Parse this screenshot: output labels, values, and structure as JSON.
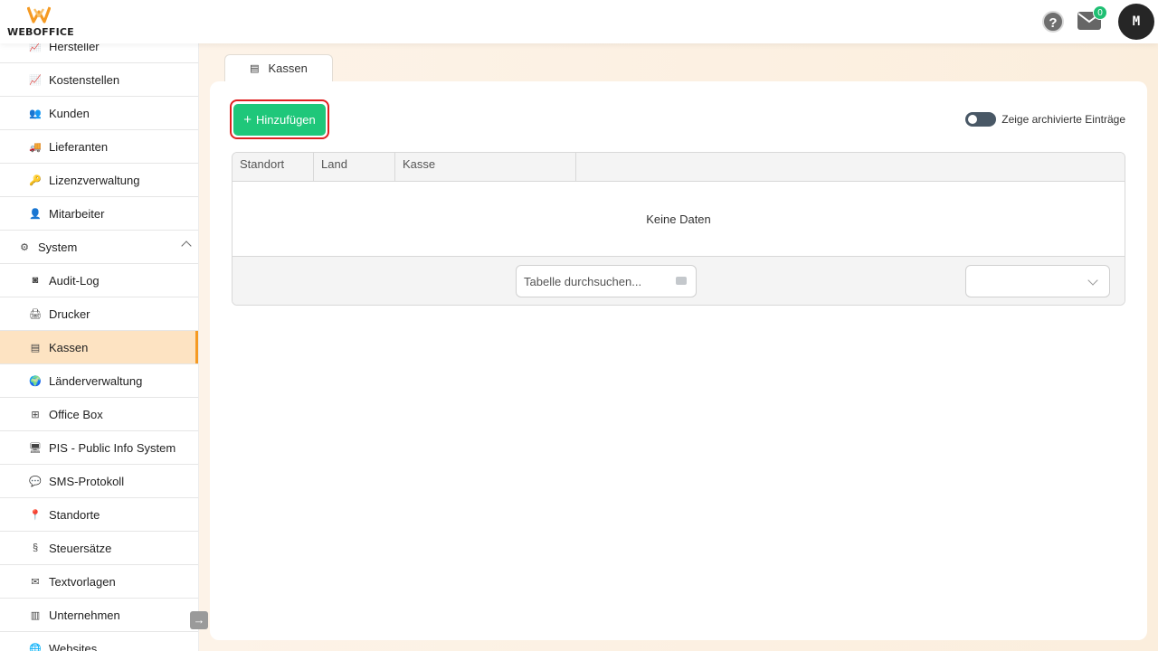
{
  "app": {
    "logo_text": "WEBOFFICE"
  },
  "header": {
    "help_label": "?",
    "mail_count": "0",
    "avatar_initial": "M"
  },
  "sidebar": {
    "items": [
      {
        "label": "Hersteller",
        "icon": "chart-icon"
      },
      {
        "label": "Kostenstellen",
        "icon": "chart-icon"
      },
      {
        "label": "Kunden",
        "icon": "users-icon"
      },
      {
        "label": "Lieferanten",
        "icon": "truck-icon"
      },
      {
        "label": "Lizenzverwaltung",
        "icon": "key-icon"
      },
      {
        "label": "Mitarbeiter",
        "icon": "user-icon"
      },
      {
        "label": "System",
        "icon": "gears-icon"
      },
      {
        "label": "Audit-Log",
        "icon": "audit-icon"
      },
      {
        "label": "Drucker",
        "icon": "printer-icon"
      },
      {
        "label": "Kassen",
        "icon": "cash-register-icon"
      },
      {
        "label": "Länderverwaltung",
        "icon": "globe-icon"
      },
      {
        "label": "Office Box",
        "icon": "sitemap-icon"
      },
      {
        "label": "PIS - Public Info System",
        "icon": "monitor-icon"
      },
      {
        "label": "SMS-Protokoll",
        "icon": "comments-icon"
      },
      {
        "label": "Standorte",
        "icon": "map-pin-icon"
      },
      {
        "label": "Steuersätze",
        "icon": "section-icon"
      },
      {
        "label": "Textvorlagen",
        "icon": "mail-bulk-icon"
      },
      {
        "label": "Unternehmen",
        "icon": "building-icon"
      },
      {
        "label": "Websites",
        "icon": "globe-icon"
      }
    ]
  },
  "tab": {
    "label": "Kassen"
  },
  "toolbar": {
    "add_label": "Hinzufügen",
    "archive_toggle_label": "Zeige archivierte Einträge"
  },
  "table": {
    "columns": [
      "Standort",
      "Land",
      "Kasse"
    ],
    "empty_text": "Keine Daten",
    "search_placeholder": "Tabelle durchsuchen...",
    "page_size": ""
  },
  "colors": {
    "accent": "#f59a23",
    "add_button": "#1fc77a",
    "active_bg": "#fde3c2",
    "badge": "#1fbf73"
  }
}
